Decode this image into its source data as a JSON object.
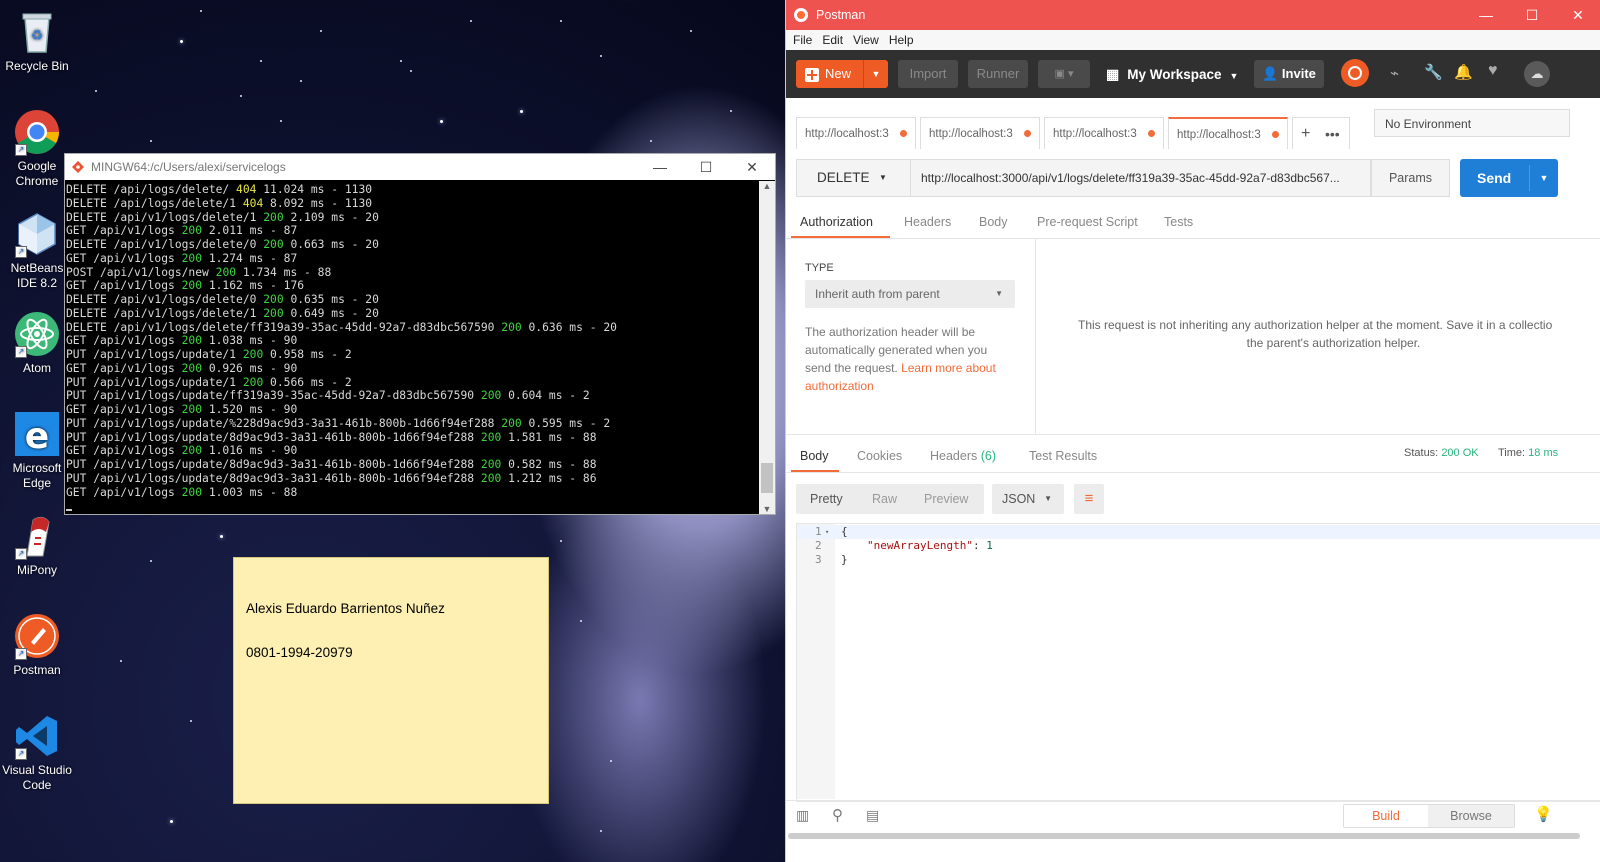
{
  "desktop": {
    "icons": [
      {
        "label": "Recycle Bin"
      },
      {
        "label": "Google Chrome"
      },
      {
        "label": "NetBeans IDE 8.2"
      },
      {
        "label": "Atom"
      },
      {
        "label": "Microsoft Edge"
      },
      {
        "label": "MiPony"
      },
      {
        "label": "Postman"
      },
      {
        "label": "Visual Studio Code"
      }
    ]
  },
  "terminal": {
    "title": "MINGW64:/c/Users/alexi/servicelogs",
    "lines": [
      {
        "req": "DELETE /api/logs/delete/ ",
        "status": "404",
        "scolor": "y",
        "rest": " 11.024 ms - 1130"
      },
      {
        "req": "DELETE /api/logs/delete/1 ",
        "status": "404",
        "scolor": "y",
        "rest": " 8.092 ms - 1130"
      },
      {
        "req": "DELETE /api/v1/logs/delete/1 ",
        "status": "200",
        "scolor": "g",
        "rest": " 2.109 ms - 20"
      },
      {
        "req": "GET /api/v1/logs ",
        "status": "200",
        "scolor": "g",
        "rest": " 2.011 ms - 87"
      },
      {
        "req": "DELETE /api/v1/logs/delete/0 ",
        "status": "200",
        "scolor": "g",
        "rest": " 0.663 ms - 20"
      },
      {
        "req": "GET /api/v1/logs ",
        "status": "200",
        "scolor": "g",
        "rest": " 1.274 ms - 87"
      },
      {
        "req": "POST /api/v1/logs/new ",
        "status": "200",
        "scolor": "g",
        "rest": " 1.734 ms - 88"
      },
      {
        "req": "GET /api/v1/logs ",
        "status": "200",
        "scolor": "g",
        "rest": " 1.162 ms - 176"
      },
      {
        "req": "DELETE /api/v1/logs/delete/0 ",
        "status": "200",
        "scolor": "g",
        "rest": " 0.635 ms - 20"
      },
      {
        "req": "DELETE /api/v1/logs/delete/1 ",
        "status": "200",
        "scolor": "g",
        "rest": " 0.649 ms - 20"
      },
      {
        "req": "DELETE /api/v1/logs/delete/ff319a39-35ac-45dd-92a7-d83dbc567590 ",
        "status": "200",
        "scolor": "g",
        "rest": " 0.636 ms - 20"
      },
      {
        "req": "GET /api/v1/logs ",
        "status": "200",
        "scolor": "g",
        "rest": " 1.038 ms - 90"
      },
      {
        "req": "PUT /api/v1/logs/update/1 ",
        "status": "200",
        "scolor": "g",
        "rest": " 0.958 ms - 2"
      },
      {
        "req": "GET /api/v1/logs ",
        "status": "200",
        "scolor": "g",
        "rest": " 0.926 ms - 90"
      },
      {
        "req": "PUT /api/v1/logs/update/1 ",
        "status": "200",
        "scolor": "g",
        "rest": " 0.566 ms - 2"
      },
      {
        "req": "PUT /api/v1/logs/update/ff319a39-35ac-45dd-92a7-d83dbc567590 ",
        "status": "200",
        "scolor": "g",
        "rest": " 0.604 ms - 2"
      },
      {
        "req": "GET /api/v1/logs ",
        "status": "200",
        "scolor": "g",
        "rest": " 1.520 ms - 90"
      },
      {
        "req": "PUT /api/v1/logs/update/%228d9ac9d3-3a31-461b-800b-1d66f94ef288 ",
        "status": "200",
        "scolor": "g",
        "rest": " 0.595 ms - 2"
      },
      {
        "req": "PUT /api/v1/logs/update/8d9ac9d3-3a31-461b-800b-1d66f94ef288 ",
        "status": "200",
        "scolor": "g",
        "rest": " 1.581 ms - 88"
      },
      {
        "req": "GET /api/v1/logs ",
        "status": "200",
        "scolor": "g",
        "rest": " 1.016 ms - 90"
      },
      {
        "req": "PUT /api/v1/logs/update/8d9ac9d3-3a31-461b-800b-1d66f94ef288 ",
        "status": "200",
        "scolor": "g",
        "rest": " 0.582 ms - 88"
      },
      {
        "req": "PUT /api/v1/logs/update/8d9ac9d3-3a31-461b-800b-1d66f94ef288 ",
        "status": "200",
        "scolor": "g",
        "rest": " 1.212 ms - 86"
      },
      {
        "req": "GET /api/v1/logs ",
        "status": "200",
        "scolor": "g",
        "rest": " 1.003 ms - 88"
      }
    ]
  },
  "sticky": {
    "line1": "Alexis Eduardo Barrientos Nuñez",
    "line2": "0801-1994-20979"
  },
  "postman": {
    "title": "Postman",
    "menu": [
      "File",
      "Edit",
      "View",
      "Help"
    ],
    "header": {
      "new": "New",
      "import": "Import",
      "runner": "Runner",
      "workspace": "My Workspace",
      "invite": "Invite"
    },
    "tabs": [
      "http://localhost:3",
      "http://localhost:3",
      "http://localhost:3",
      "http://localhost:3"
    ],
    "environment": "No Environment",
    "request": {
      "method": "DELETE",
      "url": "http://localhost:3000/api/v1/logs/delete/ff319a39-35ac-45dd-92a7-d83dbc567...",
      "params": "Params",
      "send": "Send"
    },
    "req_tabs": [
      "Authorization",
      "Headers",
      "Body",
      "Pre-request Script",
      "Tests"
    ],
    "auth": {
      "type_label": "TYPE",
      "type_value": "Inherit auth from parent",
      "desc": "The authorization header will be automatically generated when you send the request.",
      "link": "Learn more about authorization",
      "message_line1": "This request is not inheriting any authorization helper at the moment. Save it in a collectio",
      "message_line2": "the parent's authorization helper."
    },
    "resp_tabs": {
      "body": "Body",
      "cookies": "Cookies",
      "headers": "Headers",
      "headers_count": "(6)",
      "tests": "Test Results"
    },
    "status": {
      "label": "Status:",
      "value": "200 OK",
      "time_label": "Time:",
      "time_value": "18 ms"
    },
    "view": {
      "pretty": "Pretty",
      "raw": "Raw",
      "preview": "Preview",
      "format": "JSON"
    },
    "body_lines": [
      {
        "num": "1",
        "text": "{"
      },
      {
        "num": "2",
        "key": "\"newArrayLength\"",
        "sep": ": ",
        "val": "1"
      },
      {
        "num": "3",
        "text": "}"
      }
    ],
    "footer": {
      "build": "Build",
      "browse": "Browse"
    }
  }
}
